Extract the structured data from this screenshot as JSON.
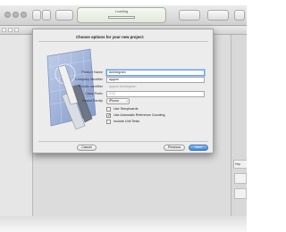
{
  "window": {
    "activity_title": "Loading",
    "controls": [
      "close",
      "minimize",
      "zoom"
    ]
  },
  "sheet": {
    "title": "Choose options for your new project:",
    "fields": [
      {
        "label": "Product Name",
        "value": "AnIntegram"
      },
      {
        "label": "Company Identifier",
        "value": "aygum"
      },
      {
        "label": "Bundle Identifier",
        "value": "aygum.AnIntegram"
      },
      {
        "label": "Class Prefix",
        "value": "XYZ"
      }
    ],
    "device": {
      "label": "Device Family",
      "value": "iPhone"
    },
    "checkboxes": [
      {
        "label": "Use Storyboards",
        "checked": false
      },
      {
        "label": "Use Automatic Reference Counting",
        "checked": true
      },
      {
        "label": "Include Unit Tests",
        "checked": false
      }
    ],
    "buttons": {
      "cancel": "Cancel",
      "previous": "Previous",
      "next": "Next"
    },
    "check_mark": "✓"
  },
  "right_pane": {
    "label": "Hep"
  },
  "colors": {
    "accent": "#3a86dc",
    "blueprint": "#9fb3dc"
  }
}
